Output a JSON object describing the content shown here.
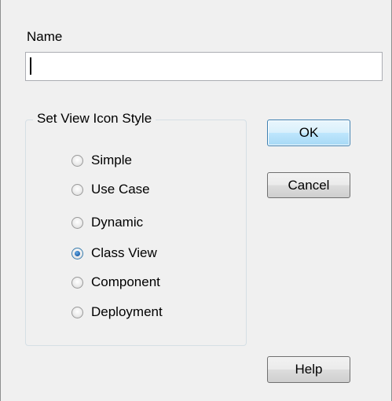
{
  "name_field": {
    "label": "Name",
    "value": ""
  },
  "icon_style_group": {
    "title": "Set View Icon Style",
    "options": [
      {
        "label": "Simple",
        "checked": false
      },
      {
        "label": "Use Case",
        "checked": false
      },
      {
        "label": "Dynamic",
        "checked": false
      },
      {
        "label": "Class View",
        "checked": true
      },
      {
        "label": "Component",
        "checked": false
      },
      {
        "label": "Deployment",
        "checked": false
      }
    ]
  },
  "buttons": {
    "ok": "OK",
    "cancel": "Cancel",
    "help": "Help"
  },
  "colors": {
    "dialog_background": "#f0f0f0",
    "default_button_border": "#3c7fb1",
    "radio_selected": "#1d5fa8"
  }
}
